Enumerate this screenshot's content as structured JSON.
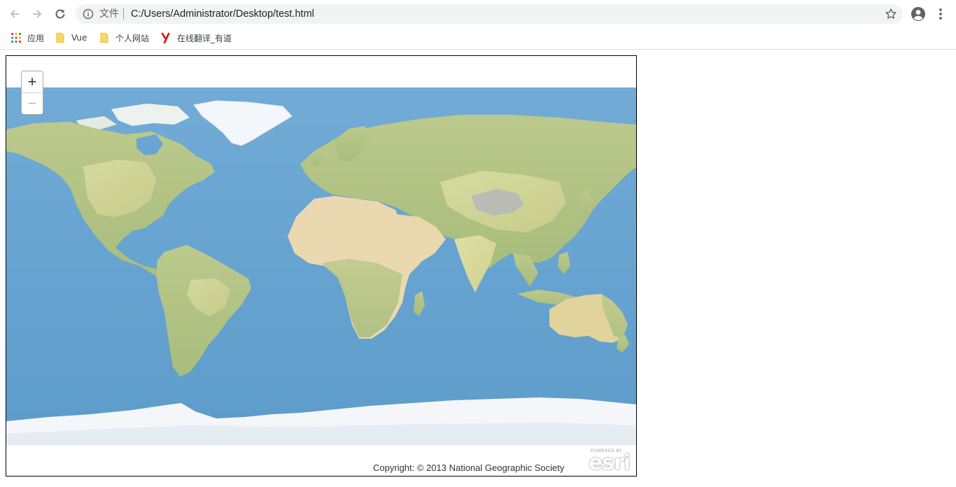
{
  "browser": {
    "file_label": "文件",
    "url": "C:/Users/Administrator/Desktop/test.html",
    "bookmarks": [
      {
        "label": "应用",
        "icon": "apps-grid-icon"
      },
      {
        "label": "Vue",
        "icon": "folder-icon"
      },
      {
        "label": "个人网站",
        "icon": "folder-icon"
      },
      {
        "label": "在线翻译_有道",
        "icon": "youdao-icon"
      }
    ]
  },
  "map": {
    "basemap": "world-satellite-imagery",
    "zoom_in_label": "+",
    "zoom_out_label": "−",
    "copyright": "Copyright: © 2013 National Geographic Society",
    "logo_text": "esri",
    "logo_powered": "POWERED BY"
  },
  "colors": {
    "ocean": "#6aa6d1",
    "land": "#d9d79a",
    "ice": "#f4f6fa",
    "omnibox": "#f1f3f4"
  }
}
